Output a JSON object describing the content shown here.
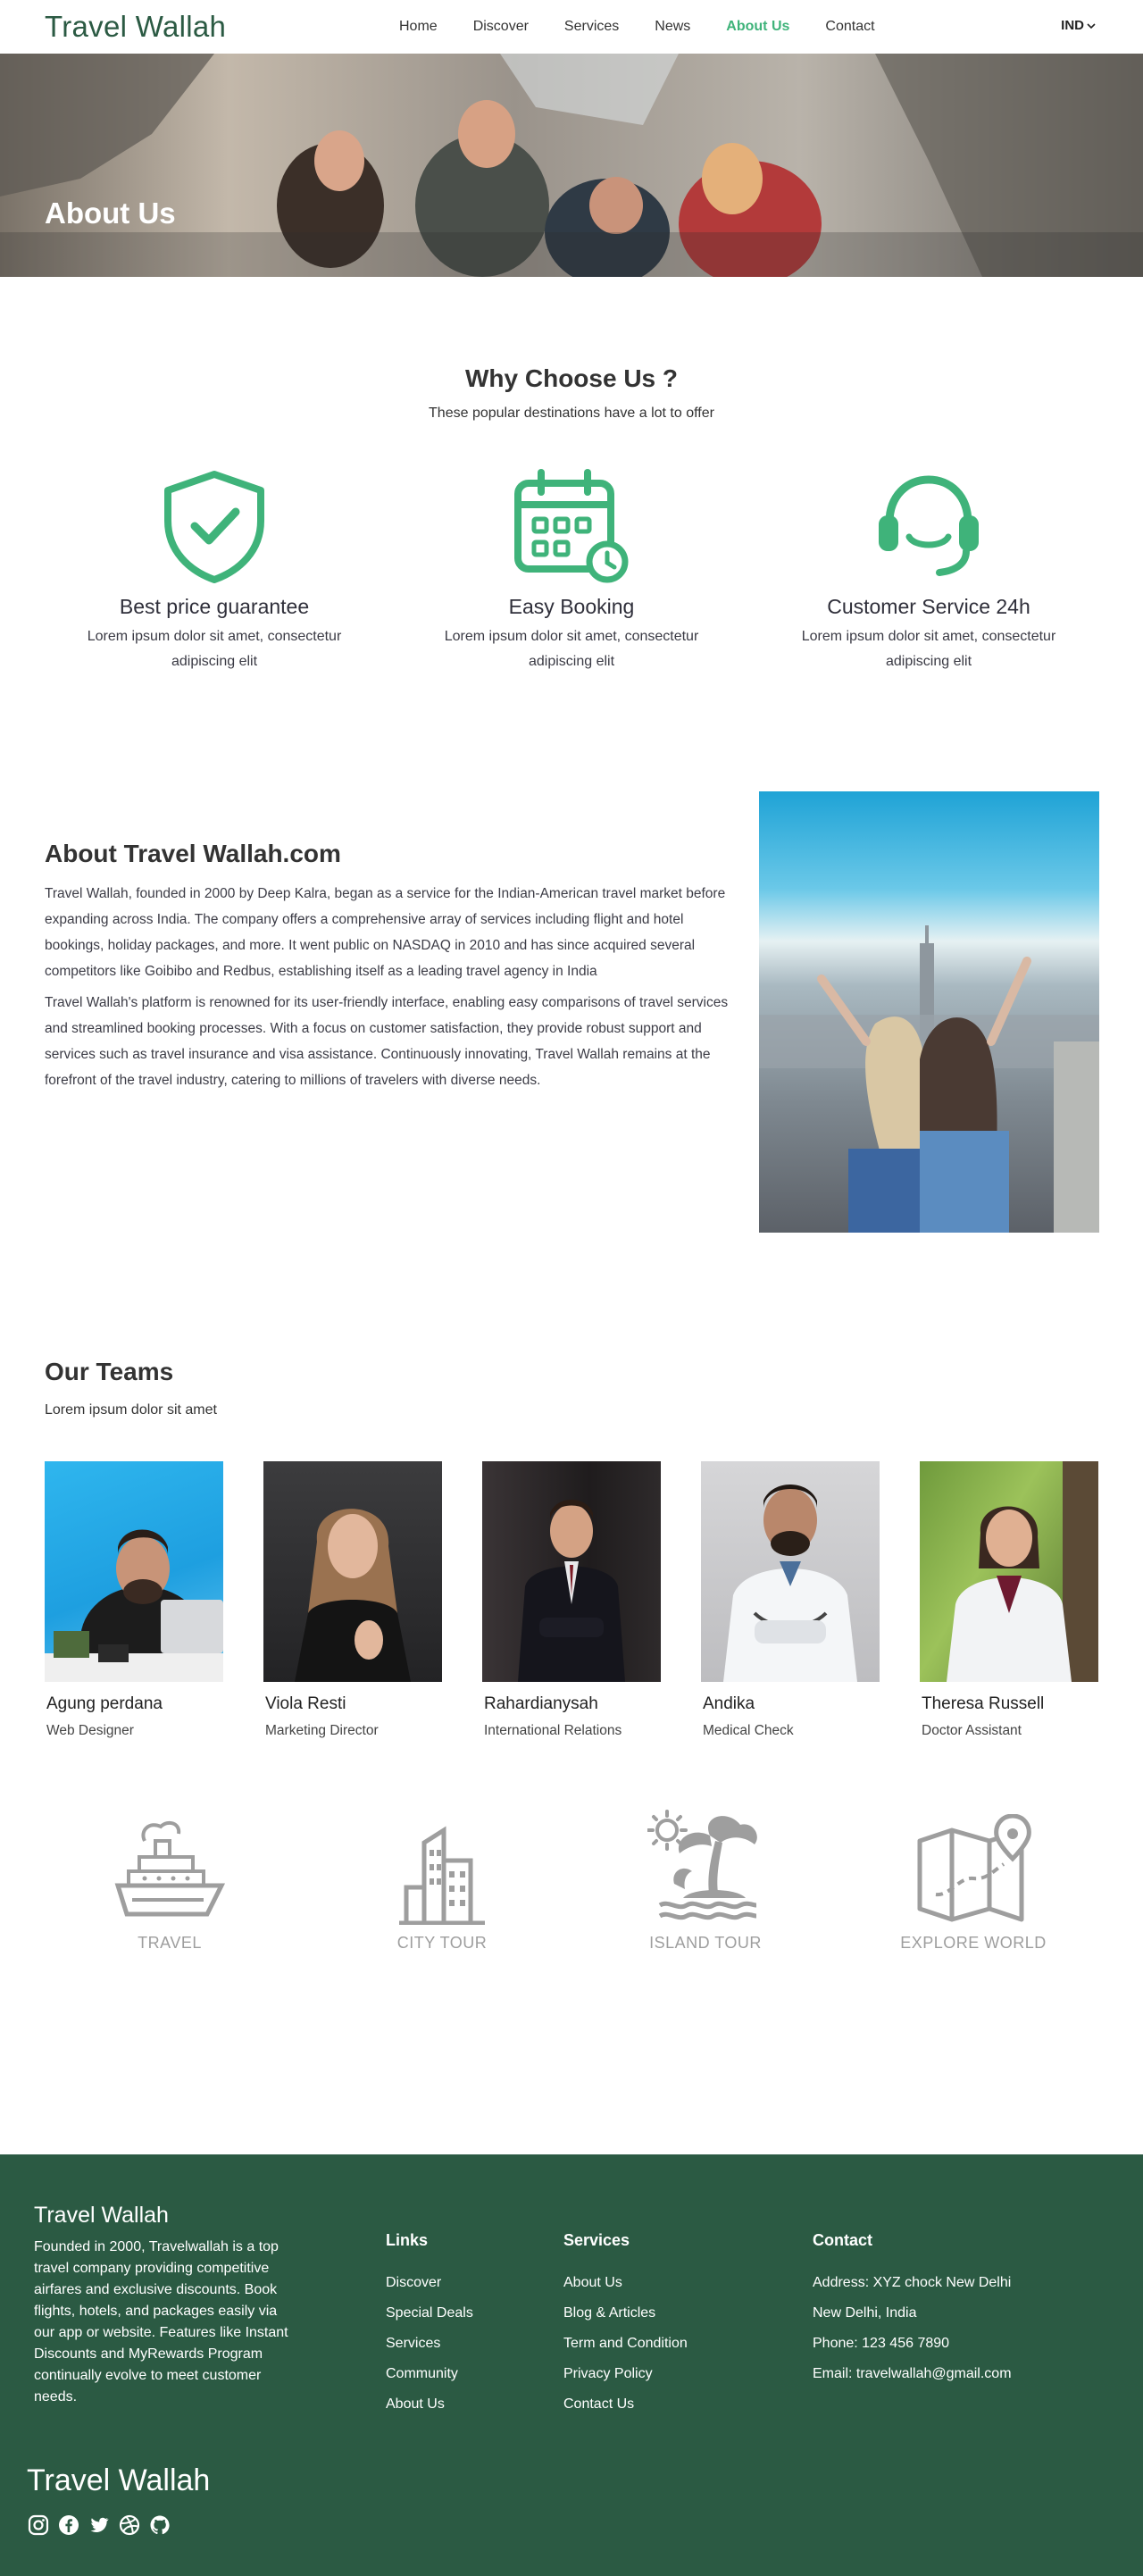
{
  "nav": {
    "brand": "Travel Wallah",
    "links": [
      "Home",
      "Discover",
      "Services",
      "News",
      "About Us",
      "Contact"
    ],
    "active": "About Us",
    "lang": "IND"
  },
  "hero": {
    "title": "About Us"
  },
  "why": {
    "title": "Why Choose Us ?",
    "subtitle": "These popular destinations have a lot to offer",
    "features": [
      {
        "title": "Best price guarantee",
        "text": "Lorem ipsum dolor sit amet, consectetur adipiscing elit",
        "icon": "shield-check-icon"
      },
      {
        "title": "Easy Booking",
        "text": "Lorem ipsum dolor sit amet, consectetur adipiscing elit",
        "icon": "calendar-clock-icon"
      },
      {
        "title": "Customer Service 24h",
        "text": "Lorem ipsum dolor sit amet, consectetur adipiscing elit",
        "icon": "headset-icon"
      }
    ]
  },
  "about": {
    "title": "About Travel Wallah.com",
    "p1": "Travel Wallah, founded in 2000 by Deep Kalra, began as a service for the Indian-American travel market before expanding across India. The company offers a comprehensive array of services including flight and hotel bookings, holiday packages, and more. It went public on NASDAQ in 2010 and has since acquired several competitors like Goibibo and Redbus, establishing itself as a leading travel agency in India",
    "p2": "Travel Wallah's platform is renowned for its user-friendly interface, enabling easy comparisons of travel services and streamlined booking processes. With a focus on customer satisfaction, they provide robust support and services such as travel insurance and visa assistance. Continuously innovating, Travel Wallah remains at the forefront of the travel industry, catering to millions of travelers with diverse needs."
  },
  "team": {
    "title": "Our Teams",
    "subtitle": "Lorem ipsum dolor sit amet",
    "members": [
      {
        "name": "Agung perdana",
        "role": "Web Designer"
      },
      {
        "name": "Viola Resti",
        "role": "Marketing Director"
      },
      {
        "name": "Rahardianysah",
        "role": "International Relations"
      },
      {
        "name": "Andika",
        "role": "Medical Check"
      },
      {
        "name": "Theresa Russell",
        "role": "Doctor Assistant"
      }
    ]
  },
  "tours": [
    {
      "label": "TRAVEL",
      "icon": "cruise-ship-icon"
    },
    {
      "label": "CITY TOUR",
      "icon": "city-building-icon"
    },
    {
      "label": "ISLAND TOUR",
      "icon": "palm-island-icon"
    },
    {
      "label": "EXPLORE WORLD",
      "icon": "map-pin-icon"
    }
  ],
  "footer": {
    "brand": "Travel Wallah",
    "description": "Founded in 2000, Travelwallah is a top travel company providing competitive airfares and exclusive discounts. Book flights, hotels, and packages easily via our app or website. Features like Instant Discounts and MyRewards Program continually evolve to meet customer needs.",
    "links": {
      "title": "Links",
      "items": [
        "Discover",
        "Special Deals",
        "Services",
        "Community",
        "About Us"
      ]
    },
    "services": {
      "title": "Services",
      "items": [
        "About Us",
        "Blog & Articles",
        "Term and Condition",
        "Privacy Policy",
        "Contact Us"
      ]
    },
    "contact": {
      "title": "Contact",
      "items": [
        "Address: XYZ chock New Delhi",
        "New Delhi, India",
        "Phone: 123 456 7890",
        "Email: travelwallah@gmail.com"
      ]
    },
    "brand_bottom": "Travel Wallah",
    "socials": [
      "instagram-icon",
      "facebook-icon",
      "twitter-icon",
      "dribbble-icon",
      "github-icon"
    ]
  },
  "colors": {
    "brand_green": "#2b5a43",
    "accent": "#3fb37a",
    "icon_grey": "#9e9e9e"
  }
}
